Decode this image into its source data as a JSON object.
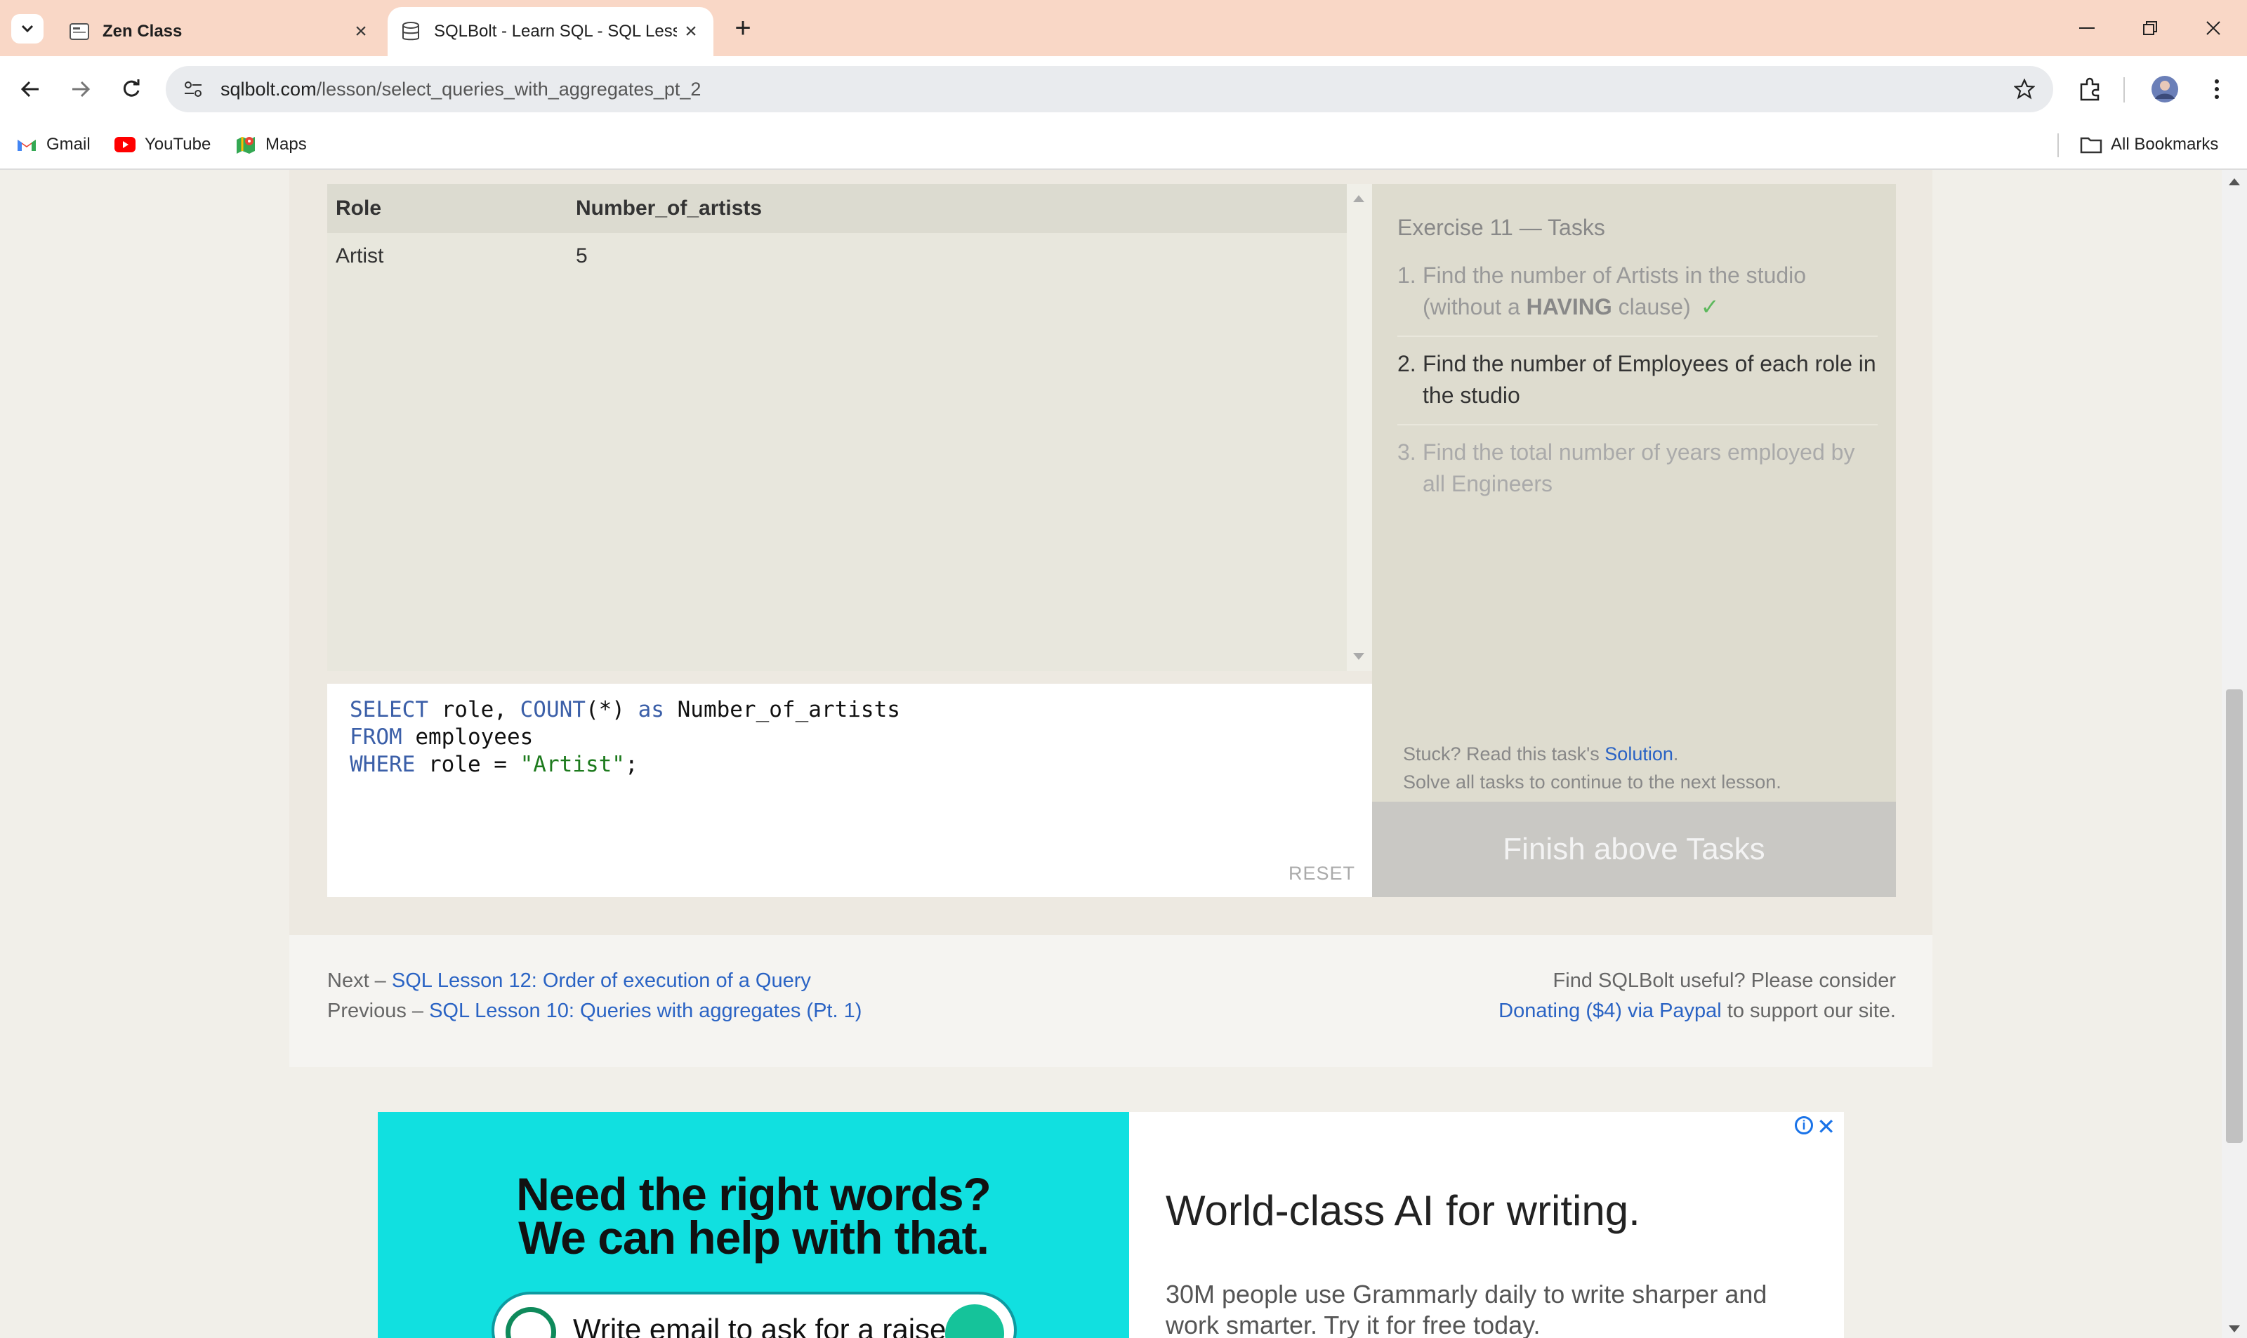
{
  "browser": {
    "tabs": [
      {
        "title": "Zen Class",
        "active": false
      },
      {
        "title": "SQLBolt - Learn SQL - SQL Less",
        "active": true
      }
    ],
    "url_host": "sqlbolt.com",
    "url_path": "/lesson/select_queries_with_aggregates_pt_2",
    "bookmarks": [
      {
        "label": "Gmail",
        "icon": "gmail-icon"
      },
      {
        "label": "YouTube",
        "icon": "youtube-icon"
      },
      {
        "label": "Maps",
        "icon": "maps-icon"
      }
    ],
    "all_bookmarks_label": "All Bookmarks"
  },
  "results": {
    "columns": [
      "Role",
      "Number_of_artists"
    ],
    "rows": [
      [
        "Artist",
        "5"
      ]
    ]
  },
  "editor": {
    "lines": [
      {
        "kw": "SELECT",
        "rest": " role, ",
        "fn": "COUNT",
        "args": "(*) ",
        "kw2": "as",
        "tail": " Number_of_artists"
      },
      {
        "kw": "FROM",
        "rest": " employees"
      },
      {
        "kw": "WHERE",
        "rest": " role = ",
        "str": "\"Artist\"",
        "tail": ";"
      }
    ],
    "reset_label": "RESET"
  },
  "tasks": {
    "title": "Exercise 11 — Tasks",
    "items": [
      {
        "num": "1.",
        "text_before": "Find the number of Artists in the studio (without a ",
        "bold": "HAVING",
        "text_after": " clause)",
        "check": "✓",
        "state": "done"
      },
      {
        "num": "2.",
        "text": "Find the number of Employees of each role in the studio",
        "state": "active"
      },
      {
        "num": "3.",
        "text": "Find the total number of years employed by all Engineers",
        "state": "pending"
      }
    ],
    "stuck_prefix": "Stuck? Read this task's ",
    "solution_link": "Solution",
    "stuck_suffix": ".",
    "continue_note": "Solve all tasks to continue to the next lesson.",
    "finish_button": "Finish above Tasks"
  },
  "footer": {
    "next_prefix": "Next – ",
    "next_link": "SQL Lesson 12: Order of execution of a Query",
    "prev_prefix": "Previous – ",
    "prev_link": "SQL Lesson 10: Queries with aggregates (Pt. 1)",
    "useful_text": "Find SQLBolt useful? Please consider",
    "donate_link": "Donating ($4) via Paypal",
    "donate_suffix": " to support our site."
  },
  "ad": {
    "headline_1": "Need the right words?",
    "headline_2": "We can help with that.",
    "input_prompt": "Write email to ask for a raise",
    "right_title": "World-class AI for writing.",
    "right_body": "30M people use Grammarly daily to write sharper and work smarter. Try it for free today.",
    "info_icon": "info-icon",
    "close_icon": "close-icon"
  }
}
